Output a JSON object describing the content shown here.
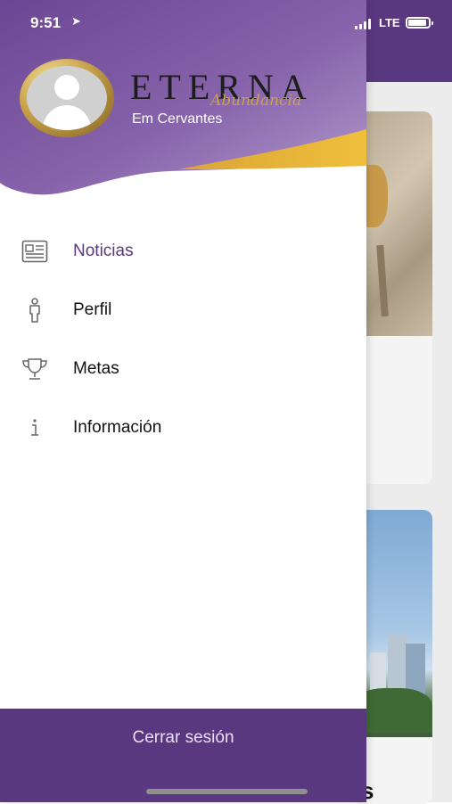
{
  "status_bar": {
    "time": "9:51",
    "network": "LTE"
  },
  "header": {
    "brand": "ETERNA",
    "brand_script": "Abundancia",
    "subtitle": "Em Cervantes"
  },
  "menu": {
    "items": [
      {
        "label": "Noticias",
        "icon": "newspaper-icon",
        "active": true
      },
      {
        "label": "Perfil",
        "icon": "person-icon",
        "active": false
      },
      {
        "label": "Metas",
        "icon": "trophy-icon",
        "active": false
      },
      {
        "label": "Información",
        "icon": "info-icon",
        "active": false
      }
    ]
  },
  "footer": {
    "logout_label": "Cerrar sesión"
  },
  "background": {
    "partial_text": "s"
  },
  "colors": {
    "primary": "#5a3880",
    "gold": "#c9a24a",
    "active_text": "#5a3880"
  }
}
